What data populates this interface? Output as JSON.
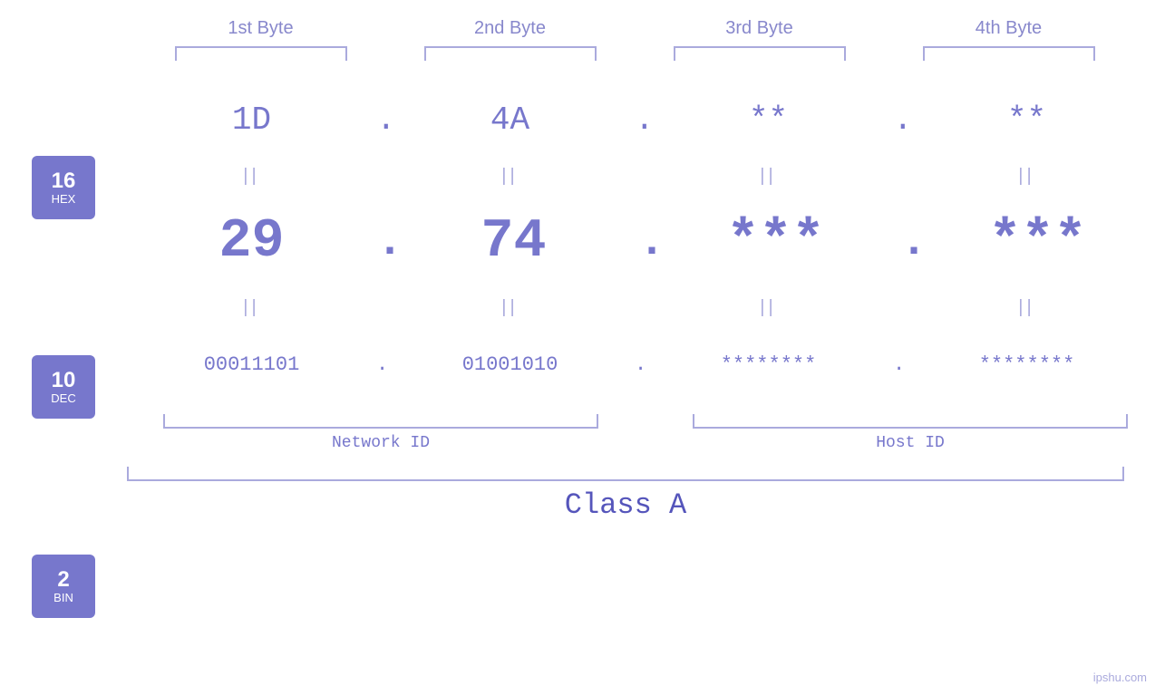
{
  "headers": {
    "byte1": "1st Byte",
    "byte2": "2nd Byte",
    "byte3": "3rd Byte",
    "byte4": "4th Byte"
  },
  "bases": {
    "hex": {
      "num": "16",
      "label": "HEX"
    },
    "dec": {
      "num": "10",
      "label": "DEC"
    },
    "bin": {
      "num": "2",
      "label": "BIN"
    }
  },
  "hex_row": {
    "b1": "1D",
    "b2": "4A",
    "b3": "**",
    "b4": "**",
    "dot": "."
  },
  "dec_row": {
    "b1": "29",
    "b2": "74",
    "b3": "***",
    "b4": "***",
    "dot": "."
  },
  "bin_row": {
    "b1": "00011101",
    "b2": "01001010",
    "b3": "********",
    "b4": "********",
    "dot": "."
  },
  "bottom": {
    "network_id": "Network ID",
    "host_id": "Host ID",
    "class": "Class A"
  },
  "watermark": "ipshu.com"
}
